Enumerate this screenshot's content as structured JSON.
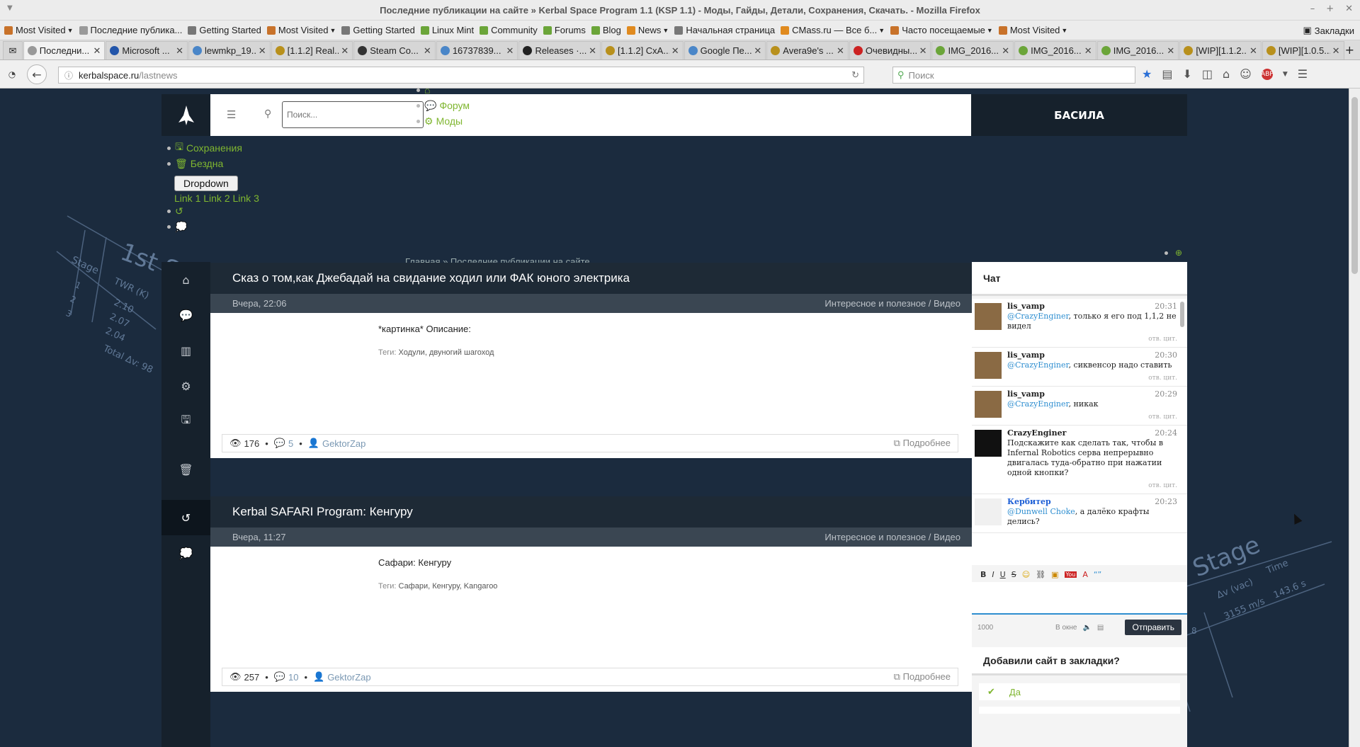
{
  "window": {
    "title": "Последние публикации на сайте » Kerbal Space Program 1.1 (KSP 1.1) - Моды, Гайды, Детали, Сохранения, Скачать. - Mozilla Firefox"
  },
  "bookmarks": [
    {
      "label": "Most Visited",
      "dropdown": true,
      "color": "#c8722a"
    },
    {
      "label": "Последние публика...",
      "dropdown": false,
      "color": "#999"
    },
    {
      "label": "Getting Started",
      "dropdown": false,
      "color": "#777"
    },
    {
      "label": "Most Visited",
      "dropdown": true,
      "color": "#c8722a"
    },
    {
      "label": "Getting Started",
      "dropdown": false,
      "color": "#777"
    },
    {
      "label": "Linux Mint",
      "dropdown": false,
      "color": "#6ba539"
    },
    {
      "label": "Community",
      "dropdown": false,
      "color": "#6ba539"
    },
    {
      "label": "Forums",
      "dropdown": false,
      "color": "#6ba539"
    },
    {
      "label": "Blog",
      "dropdown": false,
      "color": "#6ba539"
    },
    {
      "label": "News",
      "dropdown": true,
      "color": "#e08a1e"
    },
    {
      "label": "Начальная страница",
      "dropdown": false,
      "color": "#777"
    },
    {
      "label": "CMass.ru — Все б...",
      "dropdown": true,
      "color": "#e08a1e"
    },
    {
      "label": "Часто посещаемые",
      "dropdown": true,
      "color": "#c8722a"
    },
    {
      "label": "Most Visited",
      "dropdown": true,
      "color": "#c8722a"
    }
  ],
  "bookmarks_right": "Закладки",
  "tabs": [
    {
      "label": "Последни...",
      "active": true,
      "color": "#999"
    },
    {
      "label": "Microsoft ...",
      "active": false,
      "color": "#2255aa"
    },
    {
      "label": "lewmkp_19...",
      "active": false,
      "color": "#4a86c8"
    },
    {
      "label": "[1.1.2] Real...",
      "active": false,
      "color": "#b8901c"
    },
    {
      "label": "Steam Co...",
      "active": false,
      "color": "#333"
    },
    {
      "label": "16737839...",
      "active": false,
      "color": "#4a86c8"
    },
    {
      "label": "Releases ·...",
      "active": false,
      "color": "#222"
    },
    {
      "label": "[1.1.2] СхА...",
      "active": false,
      "color": "#b8901c"
    },
    {
      "label": "Google Пе...",
      "active": false,
      "color": "#4a86c8"
    },
    {
      "label": "Avera9e's ...",
      "active": false,
      "color": "#b8901c"
    },
    {
      "label": "Очевидны...",
      "active": false,
      "color": "#cc2222"
    },
    {
      "label": "IMG_2016...",
      "active": false,
      "color": "#6ba539"
    },
    {
      "label": "IMG_2016...",
      "active": false,
      "color": "#6ba539"
    },
    {
      "label": "IMG_2016...",
      "active": false,
      "color": "#6ba539"
    },
    {
      "label": "[WIP][1.1.2...",
      "active": false,
      "color": "#b8901c"
    },
    {
      "label": "[WIP][1.0.5...",
      "active": false,
      "color": "#b8901c"
    }
  ],
  "url": {
    "host": "kerbalspace.ru",
    "path": "/lastnews"
  },
  "search_placeholder": "Поиск",
  "site": {
    "search_placeholder": "Поиск...",
    "user": "БАСИЛА",
    "nav_top": [
      "Форум",
      "Моды"
    ],
    "nav_left": [
      "Сохранения",
      "Бездна"
    ],
    "dropdown_label": "Dropdown",
    "links": "Link 1 Link 2 Link 3",
    "breadcrumb": "Главная » Последние публикации на сайте"
  },
  "posts": [
    {
      "title": "Сказ о том,как Джебадай на свидание ходил или ФАК юного электрика",
      "date": "Вчера, 22:06",
      "category": "Интересное и полезное / Видео",
      "desc": "*картинка* Описание:",
      "tags_label": "Теги:",
      "tags": "Ходули, двуногий шагоход",
      "views": "176",
      "comments": "5",
      "author": "GektorZap",
      "more": "Подробнее"
    },
    {
      "title": "Kerbal SAFARI Program: Кенгуру",
      "date": "Вчера, 11:27",
      "category": "Интересное и полезное / Видео",
      "desc": "Сафари: Кенгуру",
      "tags_label": "Теги:",
      "tags": "Сафари, Кенгуру, Kangaroo",
      "views": "257",
      "comments": "10",
      "author": "GektorZap",
      "more": "Подробнее"
    }
  ],
  "chat": {
    "title": "Чат",
    "messages": [
      {
        "name": "lis_vamp",
        "time": "20:31",
        "to": "@CrazyEnginer",
        "text": ", только я его под 1,1,2 не видел",
        "actions": "отв. цит."
      },
      {
        "name": "lis_vamp",
        "time": "20:30",
        "to": "@CrazyEnginer",
        "text": ", сиквенсор надо ставить",
        "actions": "отв. цит."
      },
      {
        "name": "lis_vamp",
        "time": "20:29",
        "to": "@CrazyEnginer",
        "text": ", никак",
        "actions": "отв. цит."
      },
      {
        "name": "CrazyEnginer",
        "time": "20:24",
        "to": "",
        "text": "Подскажите как сделать так, чтобы в Infernal Robotics сервa непрерывно двигалась туда-обратно при нажатии одной кнопки?",
        "actions": "отв. цит."
      },
      {
        "name": "Кербитер",
        "time": "20:23",
        "to": "@Dunwell Choke",
        "text": ", а далёко крафты делись?",
        "actions": ""
      }
    ],
    "counter": "1000",
    "window_label": "В окне",
    "send": "Отправить"
  },
  "poll": {
    "title": "Добавили сайт в закладки?",
    "options": [
      "Да"
    ]
  },
  "background_text": {
    "stage_left": [
      "1st S",
      "Stage",
      "TWR (K)",
      "1",
      "2",
      "3",
      "2.10",
      "2.07",
      "2.04",
      "Total Δv: 98"
    ],
    "stage_right": [
      "Stage",
      "Δv (vac)",
      "Time",
      "3155 m/s",
      "143.6 s",
      "8"
    ]
  },
  "colors": {
    "accent": "#7fb630",
    "page_bg": "#1b2b3e",
    "dark": "#16212c",
    "link": "#2e8ed0"
  }
}
